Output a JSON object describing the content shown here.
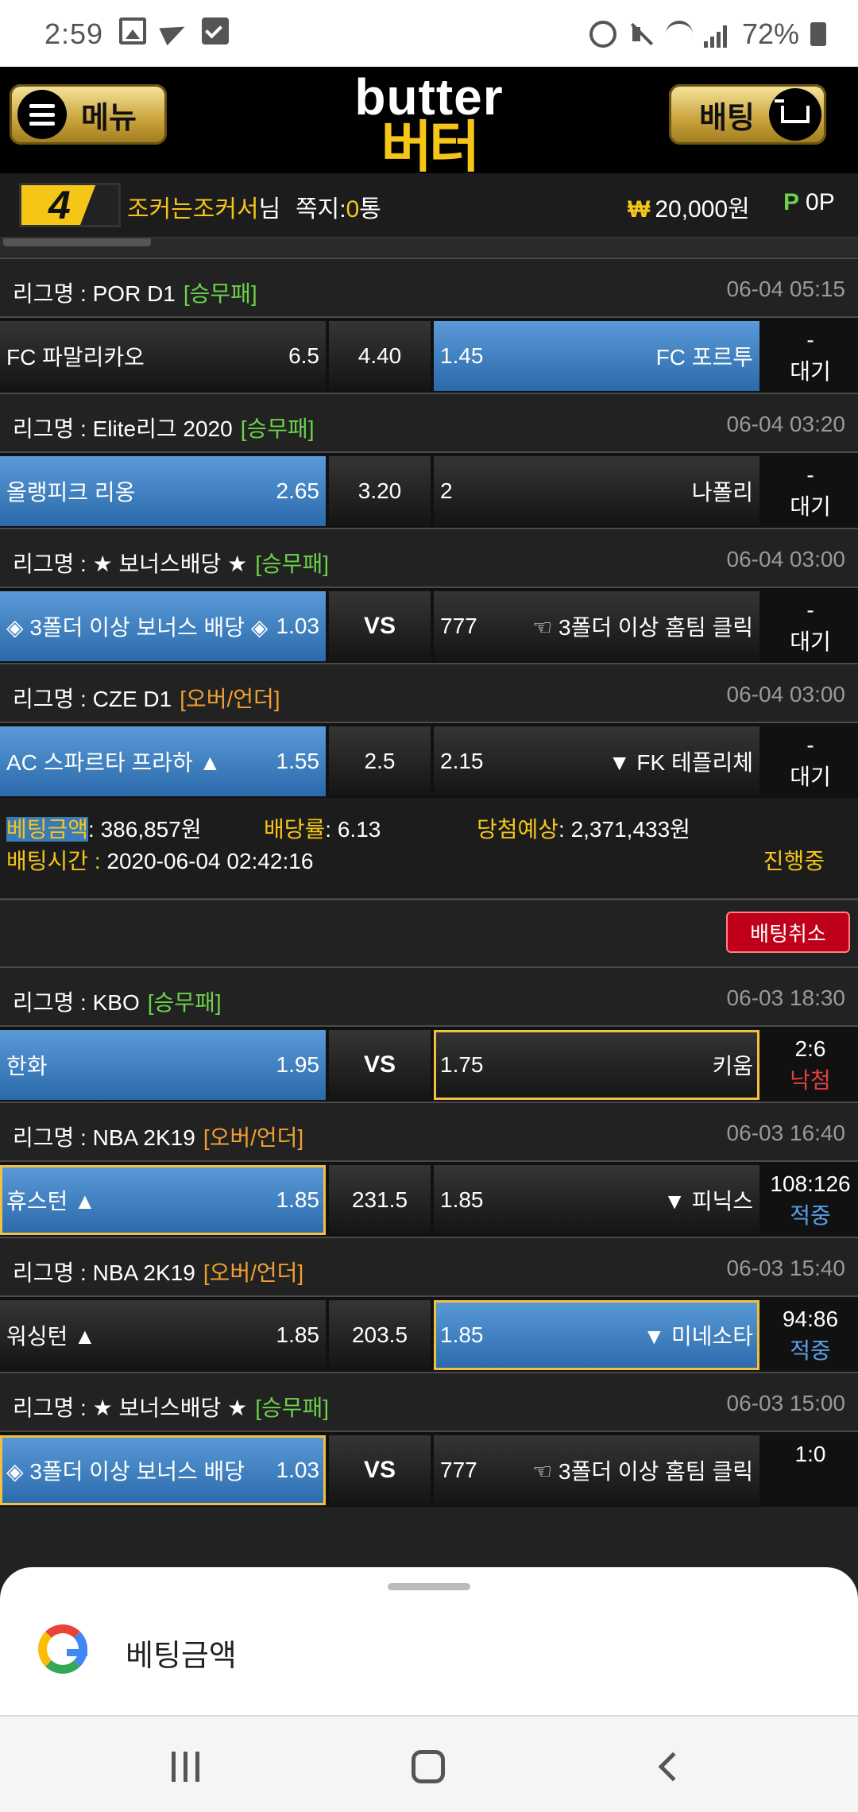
{
  "status_bar": {
    "time": "2:59",
    "battery": "72%"
  },
  "header": {
    "menu_label": "메뉴",
    "logo_en": "butter",
    "logo_ko": "버터",
    "bet_label": "배팅"
  },
  "user": {
    "level": "4",
    "name": "조커는조커서",
    "name_suffix": "님",
    "note_label": "쪽지:",
    "note_count": "0",
    "note_unit": "통",
    "money_symbol": "₩",
    "money": "20,000원",
    "points_symbol": "P",
    "points": "0P"
  },
  "matches": [
    {
      "league_prefix": "리그명 : ",
      "league": "POR D1",
      "type": "[승무패]",
      "time": "06-04 05:15",
      "home": "FC 파말리카오",
      "home_odds": "6.5",
      "mid": "4.40",
      "away_odds": "1.45",
      "away": "FC 포르투",
      "result_top": "-",
      "result_bottom": "대기"
    },
    {
      "league_prefix": "리그명 : ",
      "league": "Elite리그 2020",
      "type": "[승무패]",
      "time": "06-04 03:20",
      "home": "올랭피크 리옹",
      "home_odds": "2.65",
      "mid": "3.20",
      "away_odds": "2",
      "away": "나폴리",
      "result_top": "-",
      "result_bottom": "대기"
    },
    {
      "league_prefix": "리그명 : ",
      "league": "★ 보너스배당 ★",
      "type": "[승무패]",
      "time": "06-04 03:00",
      "home": "◈ 3폴더 이상 보너스 배당 ◈",
      "home_odds": "1.03",
      "mid": "VS",
      "away_odds": "777",
      "away": "☜ 3폴더 이상 홈팀 클릭",
      "result_top": "-",
      "result_bottom": "대기"
    },
    {
      "league_prefix": "리그명 : ",
      "league": "CZE D1",
      "type": "[오버/언더]",
      "time": "06-04 03:00",
      "home": "AC 스파르타 프라하 ▲",
      "home_odds": "1.55",
      "mid": "2.5",
      "away_odds": "2.15",
      "away": "▼ FK 테플리체",
      "result_top": "-",
      "result_bottom": "대기"
    }
  ],
  "summary1": {
    "amount_label": "베팅금액",
    "amount": ": 386,857원",
    "rate_label": "배당률",
    "rate": ": 6.13",
    "expect_label": "당첨예상",
    "expect": ": 2,371,433원",
    "time_label": "배팅시간 : ",
    "time": "2020-06-04 02:42:16",
    "status": "진행중",
    "cancel": "배팅취소"
  },
  "matches2": [
    {
      "league_prefix": "리그명 : ",
      "league": "KBO",
      "type": "[승무패]",
      "time": "06-03 18:30",
      "home": "한화",
      "home_odds": "1.95",
      "mid": "VS",
      "away_odds": "1.75",
      "away": "키움",
      "result_top": "2:6",
      "result_bottom": "낙첨"
    },
    {
      "league_prefix": "리그명 : ",
      "league": "NBA 2K19",
      "type": "[오버/언더]",
      "time": "06-03 16:40",
      "home": "휴스턴 ▲",
      "home_odds": "1.85",
      "mid": "231.5",
      "away_odds": "1.85",
      "away": "▼ 피닉스",
      "result_top": "108:126",
      "result_bottom": "적중"
    },
    {
      "league_prefix": "리그명 : ",
      "league": "NBA 2K19",
      "type": "[오버/언더]",
      "time": "06-03 15:40",
      "home": "워싱턴 ▲",
      "home_odds": "1.85",
      "mid": "203.5",
      "away_odds": "1.85",
      "away": "▼ 미네소타",
      "result_top": "94:86",
      "result_bottom": "적중"
    },
    {
      "league_prefix": "리그명 : ",
      "league": "★ 보너스배당 ★",
      "type": "[승무패]",
      "time": "06-03 15:00",
      "home": "◈ 3폴더 이상 보너스 배당",
      "home_odds": "1.03",
      "mid": "VS",
      "away_odds": "777",
      "away": "☜ 3폴더 이상 홈팀 클릭",
      "result_top": "1:0",
      "result_bottom": ""
    }
  ],
  "autofill": {
    "suggestion": "베팅금액"
  },
  "colors": {
    "accent_gold": "#f5c518",
    "selected_blue": "#3a7ab8",
    "green": "#6cd24b",
    "orange": "#f0a030",
    "lose_red": "#e04040",
    "hit_blue": "#5aa0e8"
  }
}
